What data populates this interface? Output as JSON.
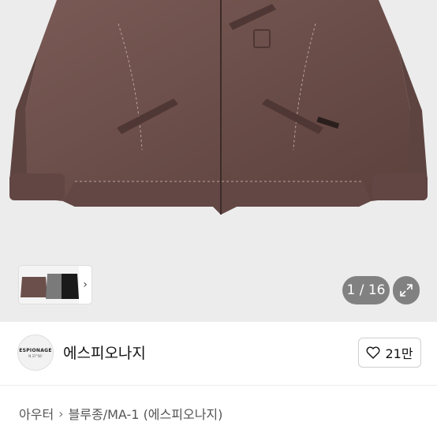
{
  "gallery": {
    "counter": "1 / 16",
    "thumb_colors": [
      "#6b4f4a",
      "#7a7a7a",
      "#1a1a1a"
    ],
    "jacket_color": "#6a4d49"
  },
  "shop": {
    "logo_text": "ESPIONAGE",
    "logo_sub": "N 37°56'",
    "name": "에스피오나지",
    "like_count": "21만"
  },
  "breadcrumb": {
    "items": [
      "아우터",
      "블루종/MA-1 (에스피오나지)"
    ]
  },
  "colors": {
    "overlay": "#000000",
    "border": "#cfcfcf"
  }
}
